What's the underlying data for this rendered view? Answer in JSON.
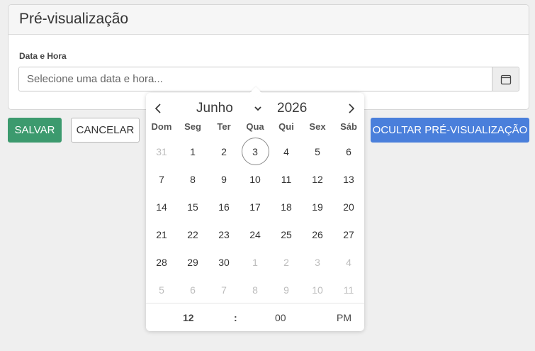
{
  "panel": {
    "title": "Pré-visualização",
    "field_label": "Data e Hora",
    "input_placeholder": "Selecione uma data e hora...",
    "input_value": ""
  },
  "buttons": {
    "save": "SALVAR",
    "cancel": "CANCELAR",
    "hide_preview": "OCULTAR PRÉ-VISUALIZAÇÃO"
  },
  "colors": {
    "save": "#3c9a6e",
    "hide_preview": "#4a7fdb"
  },
  "calendar": {
    "month": "Junho",
    "year": "2026",
    "weekdays": [
      "Dom",
      "Seg",
      "Ter",
      "Qua",
      "Qui",
      "Sex",
      "Sáb"
    ],
    "days": [
      {
        "d": "31",
        "other": true
      },
      {
        "d": "1"
      },
      {
        "d": "2"
      },
      {
        "d": "3",
        "today": true
      },
      {
        "d": "4"
      },
      {
        "d": "5"
      },
      {
        "d": "6"
      },
      {
        "d": "7"
      },
      {
        "d": "8"
      },
      {
        "d": "9"
      },
      {
        "d": "10"
      },
      {
        "d": "11"
      },
      {
        "d": "12"
      },
      {
        "d": "13"
      },
      {
        "d": "14"
      },
      {
        "d": "15"
      },
      {
        "d": "16"
      },
      {
        "d": "17"
      },
      {
        "d": "18"
      },
      {
        "d": "19"
      },
      {
        "d": "20"
      },
      {
        "d": "21"
      },
      {
        "d": "22"
      },
      {
        "d": "23"
      },
      {
        "d": "24"
      },
      {
        "d": "25"
      },
      {
        "d": "26"
      },
      {
        "d": "27"
      },
      {
        "d": "28"
      },
      {
        "d": "29"
      },
      {
        "d": "30"
      },
      {
        "d": "1",
        "other": true
      },
      {
        "d": "2",
        "other": true
      },
      {
        "d": "3",
        "other": true
      },
      {
        "d": "4",
        "other": true
      },
      {
        "d": "5",
        "other": true
      },
      {
        "d": "6",
        "other": true
      },
      {
        "d": "7",
        "other": true
      },
      {
        "d": "8",
        "other": true
      },
      {
        "d": "9",
        "other": true
      },
      {
        "d": "10",
        "other": true
      },
      {
        "d": "11",
        "other": true
      }
    ],
    "time": {
      "hour": "12",
      "separator": ":",
      "minute": "00",
      "ampm": "PM"
    }
  }
}
